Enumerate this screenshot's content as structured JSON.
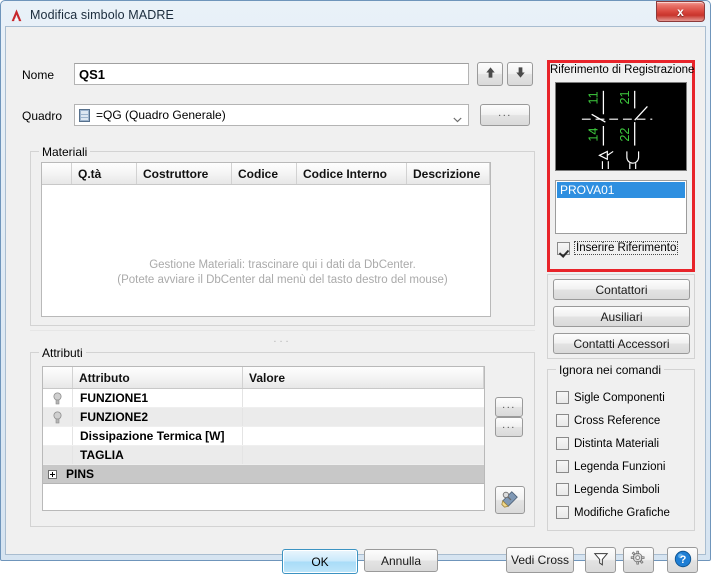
{
  "window": {
    "title": "Modifica simbolo MADRE",
    "logo_icon": "autocad-a-logo",
    "close_label": "x",
    "frame_color": "#6f95bb",
    "body_color": "#f0f0f0"
  },
  "form": {
    "nome_label": "Nome",
    "nome_value": "QS1",
    "quadro_label": "Quadro",
    "quadro_value": "=QG (Quadro Generale)",
    "quadro_icon": "cabinet-icon",
    "quadro_browse_label": "...",
    "move_up_icon": "arrow-up-icon",
    "move_down_icon": "arrow-down-icon"
  },
  "materiali": {
    "group_title": "Materiali",
    "columns": [
      "",
      "Q.tà",
      "Costruttore",
      "Codice",
      "Codice Interno",
      "Descrizione"
    ],
    "rows": [],
    "placeholder_line1": "Gestione Materiali: trascinare qui i dati da DbCenter.",
    "placeholder_line2": "(Potete avviare il DbCenter dal menù del tasto destro del mouse)"
  },
  "splitter": {
    "grip_label": "..."
  },
  "attributi": {
    "group_title": "Attributi",
    "columns": [
      "",
      "Attributo",
      "Valore"
    ],
    "rows": [
      {
        "icon": "bulb-icon",
        "attributo": "FUNZIONE1",
        "valore": ""
      },
      {
        "icon": "bulb-icon",
        "attributo": "FUNZIONE2",
        "valore": ""
      },
      {
        "icon": "",
        "attributo": "Dissipazione Termica [W]",
        "valore": ""
      },
      {
        "icon": "",
        "attributo": "TAGLIA",
        "valore": ""
      }
    ],
    "group_row": {
      "expander": "plus-icon",
      "label": "PINS"
    },
    "dots_button_1": "...",
    "dots_button_2": "...",
    "wand_icon": "magic-wand-icon"
  },
  "riferimento": {
    "group_title": "Riferimento di Registrazione",
    "highlight_color": "#e8242a",
    "preview": {
      "background": "#000000",
      "contact_labels_top": [
        "11",
        "21"
      ],
      "contact_labels_bottom": [
        "14",
        "22"
      ],
      "label_color": "#3ecb3e",
      "line_color": "#ffffff"
    },
    "list_items": [
      "PROVA01"
    ],
    "selected_item": "PROVA01",
    "selection_color": "#2e8fe0",
    "checkbox_label": "Inserire Riferimento",
    "checkbox_checked": true
  },
  "right_buttons": {
    "contattori": "Contattori",
    "ausiliari": "Ausiliari",
    "contatti_accessori": "Contatti Accessori"
  },
  "ignora": {
    "group_title": "Ignora nei comandi",
    "items": [
      {
        "label": "Sigle Componenti",
        "checked": false
      },
      {
        "label": "Cross Reference",
        "checked": false
      },
      {
        "label": "Distinta Materiali",
        "checked": false
      },
      {
        "label": "Legenda Funzioni",
        "checked": false
      },
      {
        "label": "Legenda Simboli",
        "checked": false
      },
      {
        "label": "Modifiche Grafiche",
        "checked": false
      }
    ]
  },
  "footer": {
    "ok": "OK",
    "annulla": "Annulla",
    "vedi_cross": "Vedi Cross",
    "filter_icon": "funnel-filter-icon",
    "gear_icon": "gear-settings-icon",
    "help_icon": "help-question-icon"
  }
}
